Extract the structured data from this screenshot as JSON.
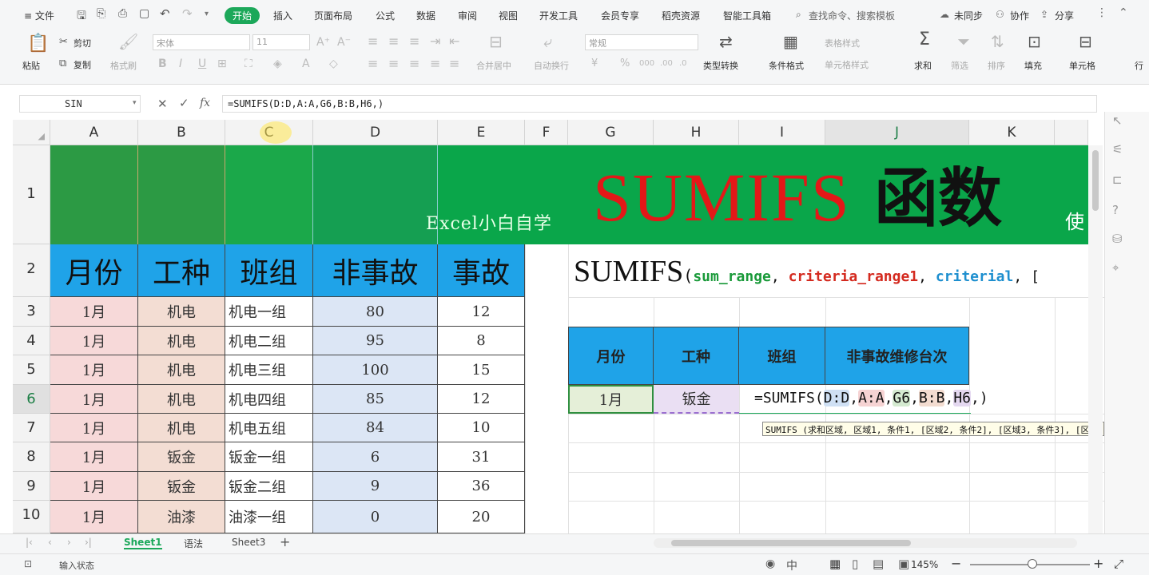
{
  "menu": {
    "items": [
      "≡ 文件",
      "开始",
      "插入",
      "页面布局",
      "公式",
      "数据",
      "审阅",
      "视图",
      "开发工具",
      "会员专享",
      "稻壳资源",
      "智能工具箱"
    ],
    "search": "查找命令、搜索模板",
    "sync": "未同步",
    "collab": "协作",
    "share": "分享"
  },
  "ribbon": {
    "paste": "粘贴",
    "cut": "剪切",
    "copy": "复制",
    "format_painter": "格式刷",
    "font": "宋体",
    "size": "11",
    "merge_center": "合并居中",
    "auto_wrap": "自动换行",
    "number_format": "常规",
    "type_convert": "类型转换",
    "cond_format": "条件格式",
    "table_style": "表格样式",
    "cell_style": "单元格样式",
    "sum": "求和",
    "filter": "筛选",
    "sort": "排序",
    "fill": "填充",
    "cell": "单元格",
    "row": "行"
  },
  "formula_bar": {
    "name_box": "SIN",
    "fx": "fx",
    "formula": "=SUMIFS(D:D,A:A,G6,B:B,H6,)"
  },
  "columns": [
    "A",
    "B",
    "C",
    "D",
    "E",
    "F",
    "G",
    "H",
    "I",
    "J",
    "K"
  ],
  "rows": [
    "1",
    "2",
    "3",
    "4",
    "5",
    "6",
    "7",
    "8",
    "9",
    "10"
  ],
  "banner": {
    "subtitle": "Excel小白自学",
    "title": "SUMIFS",
    "title_cn": "函数",
    "tail": "使"
  },
  "table_headers": [
    "月份",
    "工种",
    "班组",
    "非事故",
    "事故"
  ],
  "table_rows": [
    [
      "1月",
      "机电",
      "机电一组",
      "80",
      "12"
    ],
    [
      "1月",
      "机电",
      "机电二组",
      "95",
      "8"
    ],
    [
      "1月",
      "机电",
      "机电三组",
      "100",
      "15"
    ],
    [
      "1月",
      "机电",
      "机电四组",
      "85",
      "12"
    ],
    [
      "1月",
      "机电",
      "机电五组",
      "84",
      "10"
    ],
    [
      "1月",
      "钣金",
      "钣金一组",
      "6",
      "31"
    ],
    [
      "1月",
      "钣金",
      "钣金二组",
      "9",
      "36"
    ],
    [
      "1月",
      "油漆",
      "油漆一组",
      "0",
      "20"
    ]
  ],
  "syntax": {
    "fn": "SUMIFS",
    "open": "(",
    "arg1": "sum_range",
    "sep": ", ",
    "arg2": "criteria_range1",
    "arg3": "criterial",
    "tail": "["
  },
  "query": {
    "headers": [
      "月份",
      "工种",
      "班组",
      "非事故维修台次"
    ],
    "month": "1月",
    "type": "钣金",
    "formula_prefix": "=SUMIFS(",
    "ref1": "D:D",
    "ref2": "A:A",
    "ref3": "G6",
    "ref4": "B:B",
    "ref5": "H6",
    "formula_tail": ",)"
  },
  "tooltip": "SUMIFS (求和区域, 区域1, 条件1, [区域2, 条件2], [区域3, 条件3], [区",
  "sheets": [
    "Sheet1",
    "语法",
    "Sheet3"
  ],
  "status": {
    "mode": "输入状态",
    "zoom": "145%"
  },
  "colors": {
    "accent": "#1ca85a",
    "banner": "#0aa64a",
    "header_blue": "#1fa3e8",
    "title_red": "#e31818"
  }
}
